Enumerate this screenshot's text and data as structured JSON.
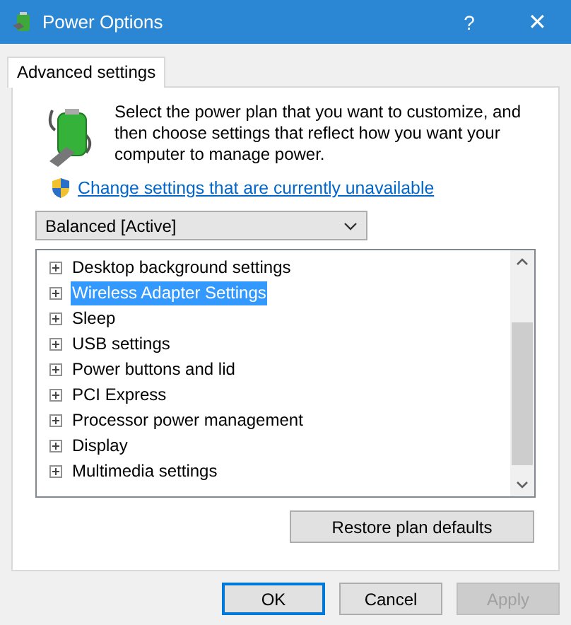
{
  "window": {
    "title": "Power Options",
    "help": "?",
    "close": "✕"
  },
  "tabs": [
    {
      "label": "Advanced settings",
      "selected": true
    }
  ],
  "intro": "Select the power plan that you want to customize, and then choose settings that reflect how you want your computer to manage power.",
  "link": "Change settings that are currently unavailable",
  "plan_dropdown": {
    "value": "Balanced [Active]"
  },
  "settings_tree": [
    {
      "label": "Desktop background settings",
      "selected": false
    },
    {
      "label": "Wireless Adapter Settings",
      "selected": true
    },
    {
      "label": "Sleep",
      "selected": false
    },
    {
      "label": "USB settings",
      "selected": false
    },
    {
      "label": "Power buttons and lid",
      "selected": false
    },
    {
      "label": "PCI Express",
      "selected": false
    },
    {
      "label": "Processor power management",
      "selected": false
    },
    {
      "label": "Display",
      "selected": false
    },
    {
      "label": "Multimedia settings",
      "selected": false
    }
  ],
  "restore_button": "Restore plan defaults",
  "buttons": [
    {
      "label": "OK",
      "default": true,
      "disabled": false
    },
    {
      "label": "Cancel",
      "default": false,
      "disabled": false
    },
    {
      "label": "Apply",
      "default": false,
      "disabled": true
    }
  ]
}
